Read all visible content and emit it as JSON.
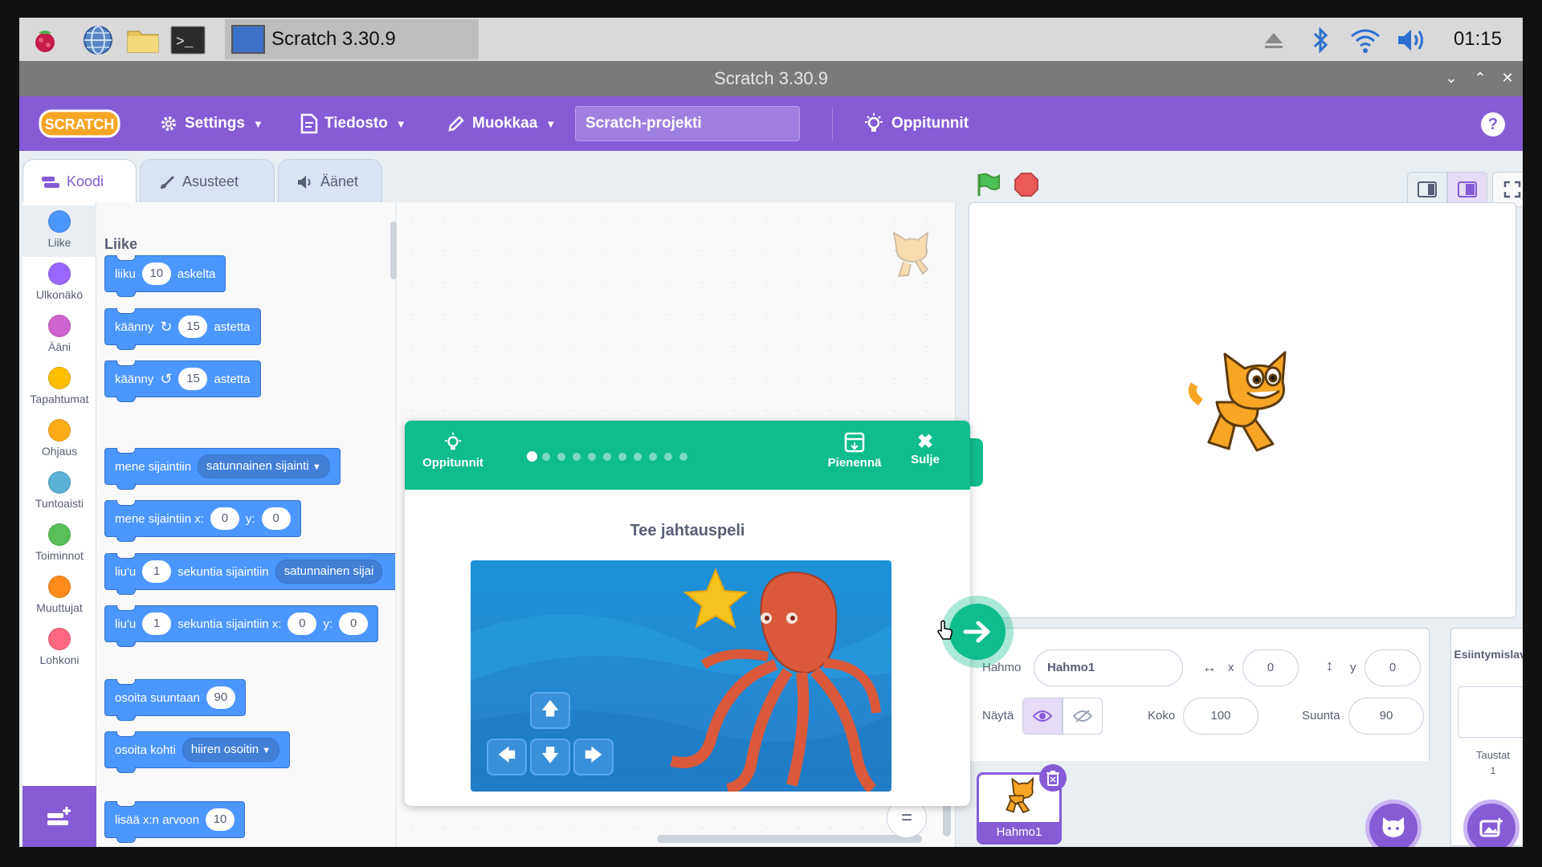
{
  "taskbar": {
    "window_label": "Scratch 3.30.9",
    "clock": "01:15"
  },
  "window": {
    "title": "Scratch 3.30.9"
  },
  "menu": {
    "logo": "SCRATCH",
    "settings": "Settings",
    "file": "Tiedosto",
    "edit": "Muokkaa",
    "project_title": "Scratch-projekti",
    "tutorials": "Oppitunnit",
    "help": "?"
  },
  "tabs": {
    "code": "Koodi",
    "costumes": "Asusteet",
    "sounds": "Äänet"
  },
  "categories": [
    {
      "label": "Liike",
      "color": "#4c97ff"
    },
    {
      "label": "Ulkonäkö",
      "color": "#9966ff"
    },
    {
      "label": "Ääni",
      "color": "#cf63cf"
    },
    {
      "label": "Tapahtumat",
      "color": "#ffbf00"
    },
    {
      "label": "Ohjaus",
      "color": "#ffab19"
    },
    {
      "label": "Tuntoaisti",
      "color": "#5cb1d6"
    },
    {
      "label": "Toiminnot",
      "color": "#59c059"
    },
    {
      "label": "Muuttujat",
      "color": "#ff8c1a"
    },
    {
      "label": "Lohkoni",
      "color": "#ff6680"
    }
  ],
  "palette": {
    "heading": "Liike",
    "b1": {
      "a": "liiku",
      "n": "10",
      "b": "askelta"
    },
    "b2": {
      "a": "käänny",
      "n": "15",
      "b": "astetta"
    },
    "b3": {
      "a": "käänny",
      "n": "15",
      "b": "astetta"
    },
    "b4": {
      "a": "mene sijaintiin",
      "d": "satunnainen sijainti"
    },
    "b5": {
      "a": "mene sijaintiin x:",
      "x": "0",
      "y_lbl": "y:",
      "y": "0"
    },
    "b6": {
      "a": "liu'u",
      "n": "1",
      "b": "sekuntia sijaintiin",
      "d": "satunnainen sijai"
    },
    "b7": {
      "a": "liu'u",
      "n": "1",
      "b": "sekuntia sijaintiin x:",
      "x": "0",
      "y_lbl": "y:",
      "y": "0"
    },
    "b8": {
      "a": "osoita suuntaan",
      "n": "90"
    },
    "b9": {
      "a": "osoita kohti",
      "d": "hiiren osoitin"
    },
    "b10": {
      "a": "lisää x:n arvoon",
      "n": "10"
    }
  },
  "tutorial": {
    "label": "Oppitunnit",
    "minimize": "Pienennä",
    "close": "Sulje",
    "title": "Tee jahtauspeli",
    "step": 1,
    "total_steps": 11
  },
  "sprite": {
    "sprite_label": "Hahmo",
    "name": "Hahmo1",
    "x": "0",
    "y": "0",
    "show_label": "Näytä",
    "size_label": "Koko",
    "size": "100",
    "direction_label": "Suunta",
    "direction": "90",
    "thumb_name": "Hahmo1"
  },
  "stage_panel": {
    "title": "Esiintymislava",
    "backdrops_label": "Taustat",
    "backdrops_count": "1"
  },
  "colors": {
    "scratch_purple": "#855cd6",
    "motion_blue": "#4c97ff",
    "tutorial_green": "#0fbd8c"
  }
}
